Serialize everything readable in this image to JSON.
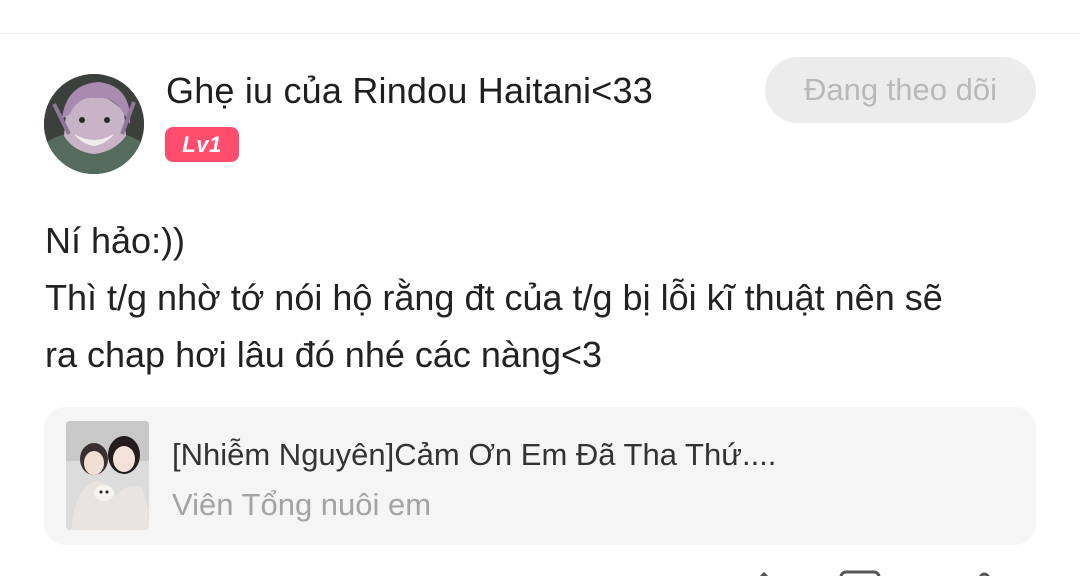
{
  "post": {
    "author": {
      "name": "Ghẹ iu của Rindou Haitani<33",
      "level": "Lv1"
    },
    "follow_button_label": "Đang theo dõi",
    "body_lines": [
      "Ní hảo:))",
      "Thì t/g nhờ tớ nói hộ rằng đt của t/g bị lỗi kĩ thuật nên sẽ",
      "ra chap hơi lâu đó nhé các nàng<3"
    ],
    "linked_story": {
      "title": "[Nhiễm Nguyên]Cảm Ơn Em Đã Tha Thứ....",
      "subtitle": "Viên Tổng nuôi em"
    }
  },
  "colors": {
    "badge": "#ff4d6d",
    "follow_button_bg": "#ececec",
    "follow_button_text": "#b9b9b9",
    "card_bg": "#f5f5f5",
    "subtitle_text": "#a3a3a3"
  },
  "icons": [
    "avatar-image",
    "story-cover-image",
    "share-icon",
    "comment-icon",
    "like-icon"
  ]
}
